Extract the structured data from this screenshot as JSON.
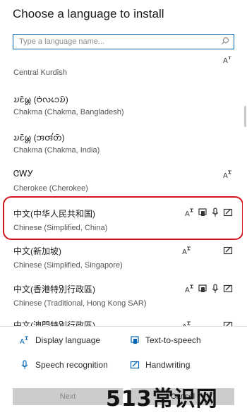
{
  "dialog": {
    "title": "Choose a language to install"
  },
  "search": {
    "placeholder": "Type a language name..."
  },
  "languages": [
    {
      "native": "",
      "english": "Central Kurdish"
    },
    {
      "native": "𑄌𑄋𑄴𑄟𑄳𑄦 (𑄝𑄁𑄣𑄘𑄬𑄌𑄴)",
      "english": "Chakma (Chakma, Bangladesh)"
    },
    {
      "native": "𑄌𑄋𑄴𑄟𑄳𑄦 (𑄞𑄢𑄧𑄖𑄴)",
      "english": "Chakma (Chakma, India)"
    },
    {
      "native": "ᏣᎳᎩ",
      "english": "Cherokee (Cherokee)"
    },
    {
      "native": "中文(中华人民共和国)",
      "english": "Chinese (Simplified, China)"
    },
    {
      "native": "中文(新加坡)",
      "english": "Chinese (Simplified, Singapore)"
    },
    {
      "native": "中文(香港特別行政區)",
      "english": "Chinese (Traditional, Hong Kong SAR)"
    },
    {
      "native": "中文(澳門特別行政區)",
      "english": ""
    }
  ],
  "legend": {
    "display_language": "Display language",
    "text_to_speech": "Text-to-speech",
    "speech_recognition": "Speech recognition",
    "handwriting": "Handwriting"
  },
  "footer": {
    "next": "Next",
    "cancel": "Cancel"
  },
  "watermark": {
    "text": "513常识网"
  },
  "colors": {
    "accent": "#0063b1",
    "highlight_ring": "#d4141b"
  }
}
